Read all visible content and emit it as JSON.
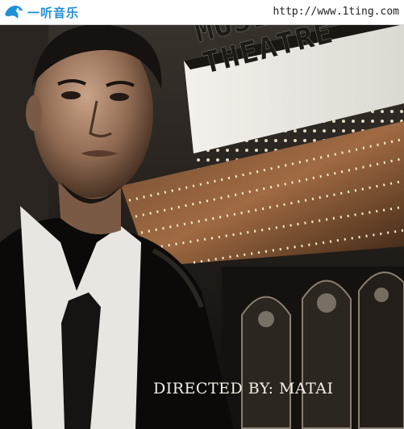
{
  "watermark": {
    "logo_text": "一听音乐",
    "url": "http://www.1ting.com",
    "icon": "dolphin-logo-icon",
    "brand_color": "#1f8fd6"
  },
  "cover": {
    "marquee_line1": "MUSICAL",
    "marquee_line2": "THEATRE",
    "caption": "DIRECTED BY: MATAI"
  }
}
